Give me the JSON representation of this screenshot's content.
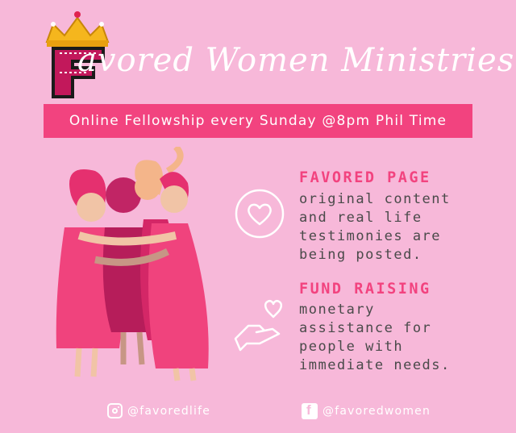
{
  "brand": {
    "logo_letter": "F",
    "title": "avored Women Ministries"
  },
  "banner": {
    "text": "Online Fellowship every Sunday @8pm Phil Time"
  },
  "features": [
    {
      "icon": "heart-icon",
      "title": "FAVORED PAGE",
      "description": "original content\nand real life\ntestimonies are\nbeing posted."
    },
    {
      "icon": "hand-heart-icon",
      "title": "FUND RAISING",
      "description": "monetary\nassistance for\npeople with\nimmediate needs."
    }
  ],
  "social": {
    "instagram": "@favoredlife",
    "facebook": "@favoredwomen"
  },
  "colors": {
    "background": "#f7b8d9",
    "accent": "#f2437f",
    "text_dark": "#4a4a4a",
    "white": "#ffffff"
  }
}
